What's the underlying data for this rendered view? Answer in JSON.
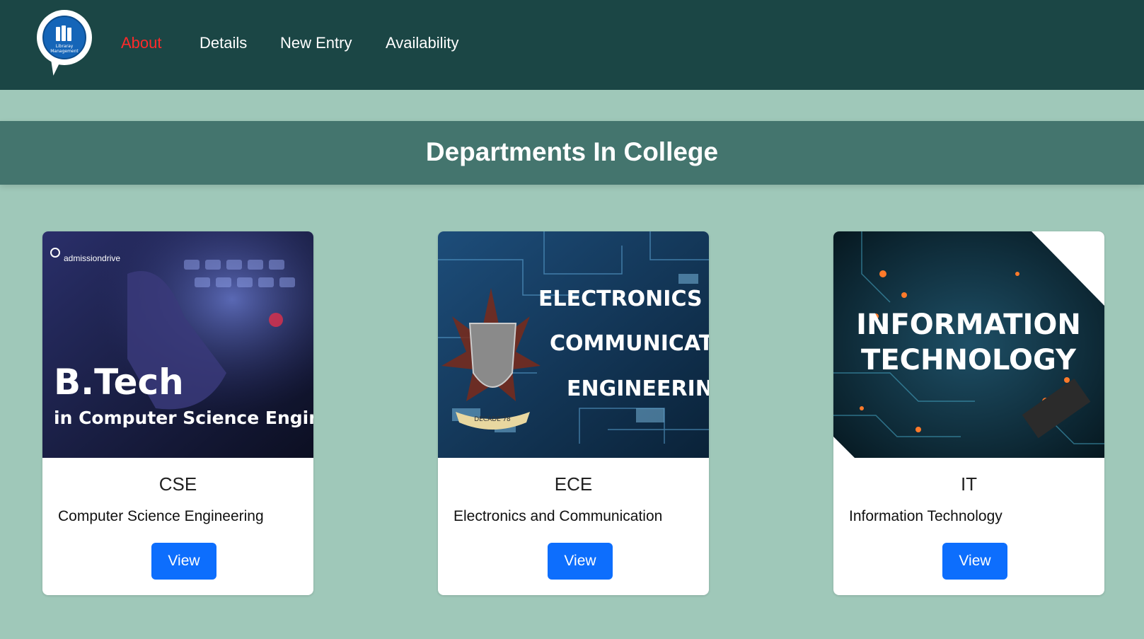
{
  "nav": {
    "logo_text_line1": "Libraray",
    "logo_text_line2": "Management",
    "links": [
      {
        "label": "About",
        "active": true
      },
      {
        "label": "Details",
        "active": false
      },
      {
        "label": "New Entry",
        "active": false
      },
      {
        "label": "Availability",
        "active": false
      }
    ]
  },
  "banner": {
    "title": "Departments In College"
  },
  "cards": [
    {
      "image_text": {
        "brand": "admissiondrive",
        "line1": "B.Tech",
        "line2": "in Computer Science Engineering"
      },
      "title": "CSE",
      "description": "Computer Science Engineering",
      "button": "View"
    },
    {
      "image_text": {
        "line1": "ELECTRONICS AND",
        "line2": "COMMUNICATIONS",
        "line3": "ENGINEERING",
        "badge": "DECADE'78"
      },
      "title": "ECE",
      "description": "Electronics and Communication",
      "button": "View"
    },
    {
      "image_text": {
        "line1": "INFORMATION",
        "line2": "TECHNOLOGY"
      },
      "title": "IT",
      "description": "Information Technology",
      "button": "View"
    }
  ],
  "colors": {
    "navbar": "#1b4645",
    "page_bg": "#9fc8b9",
    "banner": "#44756e",
    "active_link": "#ff2a2a",
    "button": "#0d6efd"
  }
}
